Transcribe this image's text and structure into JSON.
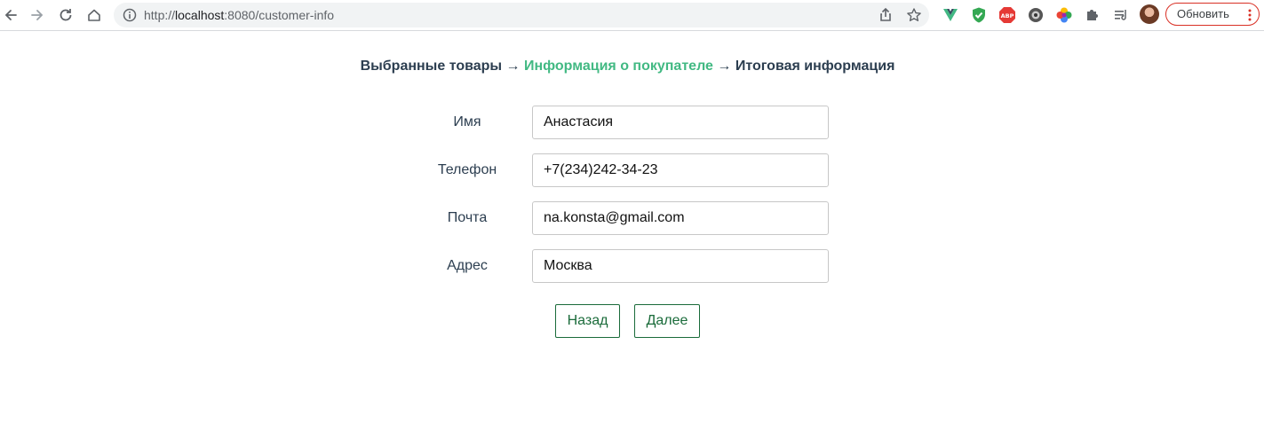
{
  "browser": {
    "url_prefix": "http://",
    "url_host": "localhost",
    "url_rest": ":8080/customer-info",
    "update_label": "Обновить",
    "extensions": [
      "vue-devtools-icon",
      "shield-extension-icon",
      "adblock-icon",
      "camera-extension-icon",
      "color-wheel-extension-icon",
      "puzzle-extensions-icon",
      "reading-list-icon"
    ]
  },
  "breadcrumb": {
    "step1": "Выбранные товары",
    "arrow1": " → ",
    "step2": "Информация о покупателе",
    "arrow2": " → ",
    "step3": "Итоговая информация"
  },
  "form": {
    "name_label": "Имя",
    "name_value": "Анастасия",
    "phone_label": "Телефон",
    "phone_value": "+7(234)242-34-23",
    "email_label": "Почта",
    "email_value": "na.konsta@gmail.com",
    "address_label": "Адрес",
    "address_value": "Москва"
  },
  "buttons": {
    "back": "Назад",
    "next": "Далее"
  },
  "colors": {
    "accent": "#42b983",
    "text": "#2c3e50",
    "button_border": "#1a6b3a"
  }
}
